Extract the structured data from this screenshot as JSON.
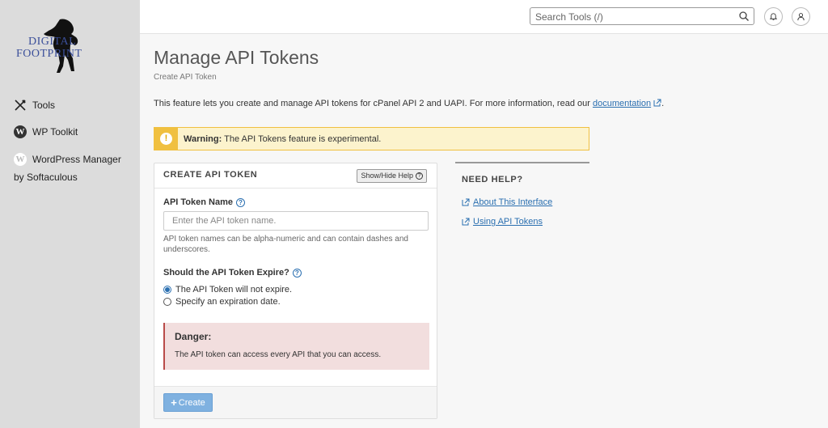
{
  "brand": {
    "logo_text_line1": "DIGITAL",
    "logo_text_line2": "FOOTPRINT"
  },
  "sidebar": {
    "items": [
      {
        "label": "Tools",
        "icon": "tools-icon"
      },
      {
        "label": "WP Toolkit",
        "icon": "wordpress-icon"
      },
      {
        "label": "WordPress Manager",
        "label_line2": "by Softaculous",
        "icon": "wordpress-icon"
      }
    ]
  },
  "header": {
    "search": {
      "placeholder": "Search Tools (/)"
    },
    "icons": [
      "search-icon",
      "bell-icon",
      "user-icon"
    ]
  },
  "page": {
    "title": "Manage API Tokens",
    "breadcrumb": "Create API Token",
    "intro_text": "This feature lets you create and manage API tokens for cPanel API 2 and UAPI. For more information, read our",
    "intro_link": "documentation",
    "intro_end": "."
  },
  "warning": {
    "icon": "!",
    "label": "Warning:",
    "text": "The API Tokens feature is experimental."
  },
  "form": {
    "title": "CREATE API TOKEN",
    "help_toggle": "Show/Hide Help",
    "token_name_label": "API Token Name",
    "token_name_placeholder": "Enter the API token name.",
    "token_name_value": "",
    "token_name_hint": "API token names can be alpha-numeric and can contain dashes and underscores.",
    "expire_label": "Should the API Token Expire?",
    "expire_options": [
      {
        "label": "The API Token will not expire.",
        "selected": true
      },
      {
        "label": "Specify an expiration date.",
        "selected": false
      }
    ],
    "danger_title": "Danger:",
    "danger_text": "The API token can access every API that you can access.",
    "create_button": "Create"
  },
  "help": {
    "title": "NEED HELP?",
    "links": [
      "About This Interface",
      "Using API Tokens"
    ]
  },
  "colors": {
    "sidebar_bg": "#dcdcdc",
    "link": "#2a6fb0",
    "warning_bg": "#fcf3cd",
    "warning_accent": "#f0c040",
    "danger_bg": "#f2dede",
    "danger_accent": "#b94a48",
    "primary_button": "#7fb1e0"
  }
}
